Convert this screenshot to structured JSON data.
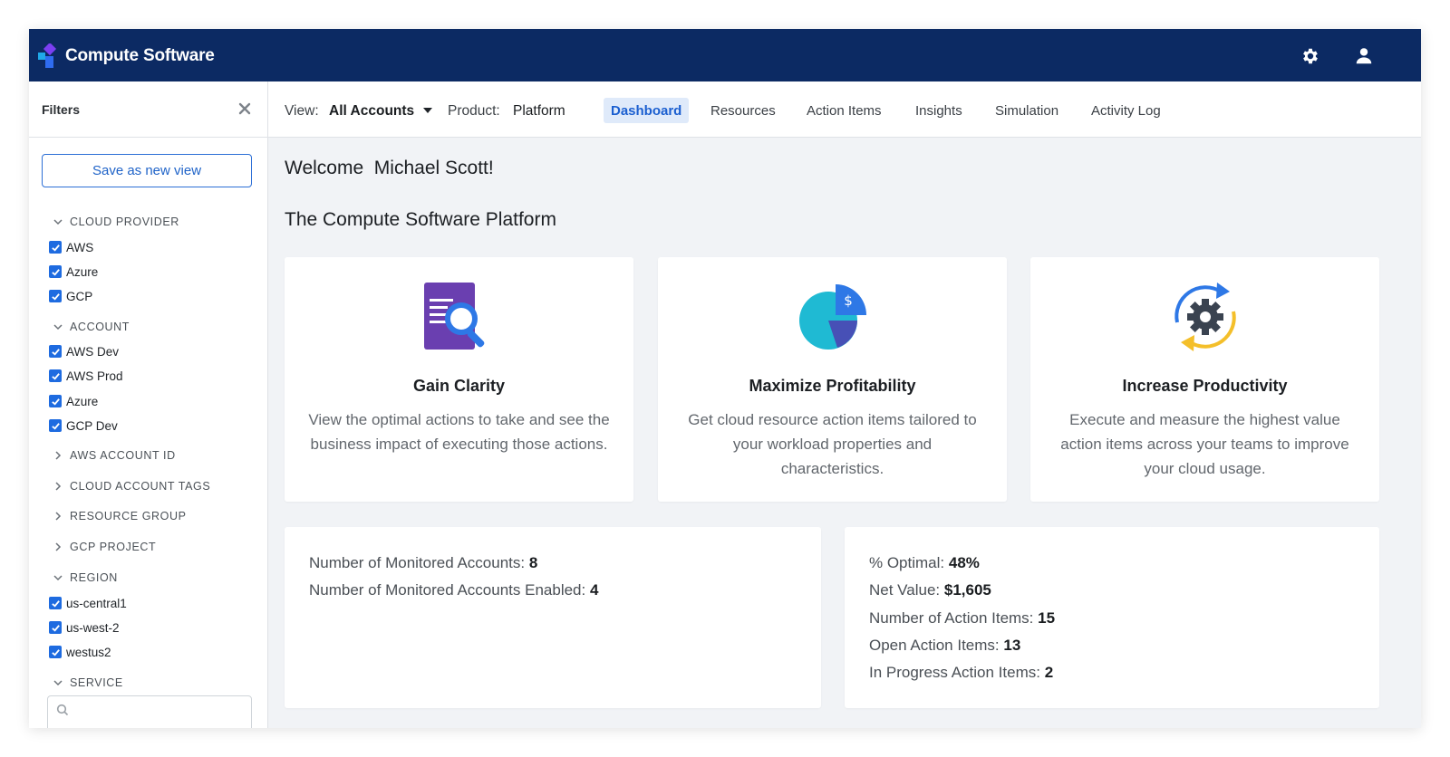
{
  "app": {
    "brand": "Compute Software",
    "colors": {
      "topbar": "#0c2a63",
      "accent": "#1e6be0",
      "tab_active_bg": "#dfeafa"
    }
  },
  "topbar_icons": [
    "gear-icon",
    "user-icon"
  ],
  "sidebar": {
    "title": "Filters",
    "save_view_label": "Save as new view",
    "groups": {
      "cloud_provider": {
        "label": "CLOUD PROVIDER",
        "items": [
          "AWS",
          "Azure",
          "GCP"
        ]
      },
      "account": {
        "label": "ACCOUNT",
        "items": [
          "AWS Dev",
          "AWS Prod",
          "Azure",
          "GCP Dev"
        ]
      },
      "aws_account_id": {
        "label": "AWS ACCOUNT ID"
      },
      "cloud_account_tags": {
        "label": "CLOUD ACCOUNT TAGS"
      },
      "resource_group": {
        "label": "RESOURCE GROUP"
      },
      "gcp_project": {
        "label": "GCP PROJECT"
      },
      "region": {
        "label": "REGION",
        "items": [
          "us-central1",
          "us-west-2",
          "westus2"
        ]
      },
      "service": {
        "label": "SERVICE"
      }
    }
  },
  "nav": {
    "view_label": "View:",
    "view_value": "All Accounts",
    "product_label": "Product:",
    "product_value": "Platform",
    "tabs": [
      "Dashboard",
      "Resources",
      "Action Items",
      "Insights",
      "Simulation",
      "Activity Log"
    ],
    "active_tab": "Dashboard"
  },
  "main": {
    "welcome": "Welcome  Michael Scott!",
    "platform_title": "The Compute Software Platform",
    "features": [
      {
        "title": "Gain Clarity",
        "description": "View the optimal actions to take and see the business impact of executing those actions.",
        "icon": "report-search-icon"
      },
      {
        "title": "Maximize Profitability",
        "description": "Get cloud resource action items tailored to your workload properties and characteristics.",
        "icon": "pie-chart-dollar-icon"
      },
      {
        "title": "Increase Productivity",
        "description": "Execute and measure the highest value action items across your teams to improve your cloud usage.",
        "icon": "gear-cycle-icon"
      }
    ],
    "accounts_stats": [
      {
        "label": "Number of Monitored Accounts:",
        "value": "8"
      },
      {
        "label": "Number of Monitored Accounts Enabled:",
        "value": "4"
      }
    ],
    "action_stats": [
      {
        "label": "% Optimal:",
        "value": "48%"
      },
      {
        "label": "Net Value:",
        "value": "$1,605"
      },
      {
        "label": "Number of Action Items:",
        "value": "15"
      },
      {
        "label": "Open Action Items:",
        "value": "13"
      },
      {
        "label": "In Progress Action Items:",
        "value": "2"
      }
    ]
  }
}
